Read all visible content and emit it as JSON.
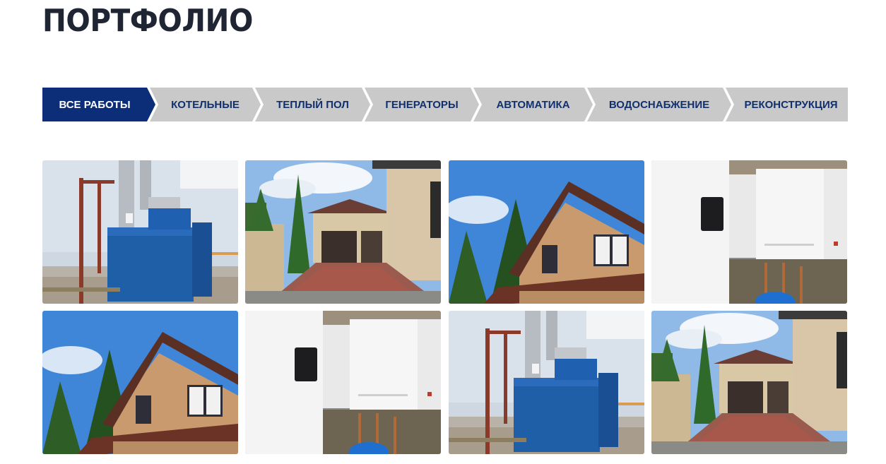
{
  "page": {
    "title": "ПОРТФОЛИО"
  },
  "filters": {
    "tabs": [
      {
        "label": "ВСЕ РАБОТЫ",
        "active": true
      },
      {
        "label": "КОТЕЛЬНЫЕ",
        "active": false
      },
      {
        "label": "ТЕПЛЫЙ ПОЛ",
        "active": false
      },
      {
        "label": "ГЕНЕРАТОРЫ",
        "active": false
      },
      {
        "label": "АВТОМАТИКА",
        "active": false
      },
      {
        "label": "ВОДОСНАБЖЕНИЕ",
        "active": false
      },
      {
        "label": "РЕКОНСТРУКЦИЯ",
        "active": false
      }
    ],
    "active_color": "#0c2d78",
    "inactive_color": "#c9c9c9",
    "text_color": "#10306e"
  },
  "gallery": {
    "items": [
      {
        "subject": "boiler-room"
      },
      {
        "subject": "driveway-garage"
      },
      {
        "subject": "house-exterior"
      },
      {
        "subject": "wall-boilers"
      },
      {
        "subject": "house-exterior"
      },
      {
        "subject": "wall-boilers"
      },
      {
        "subject": "boiler-room"
      },
      {
        "subject": "driveway-garage"
      }
    ]
  }
}
